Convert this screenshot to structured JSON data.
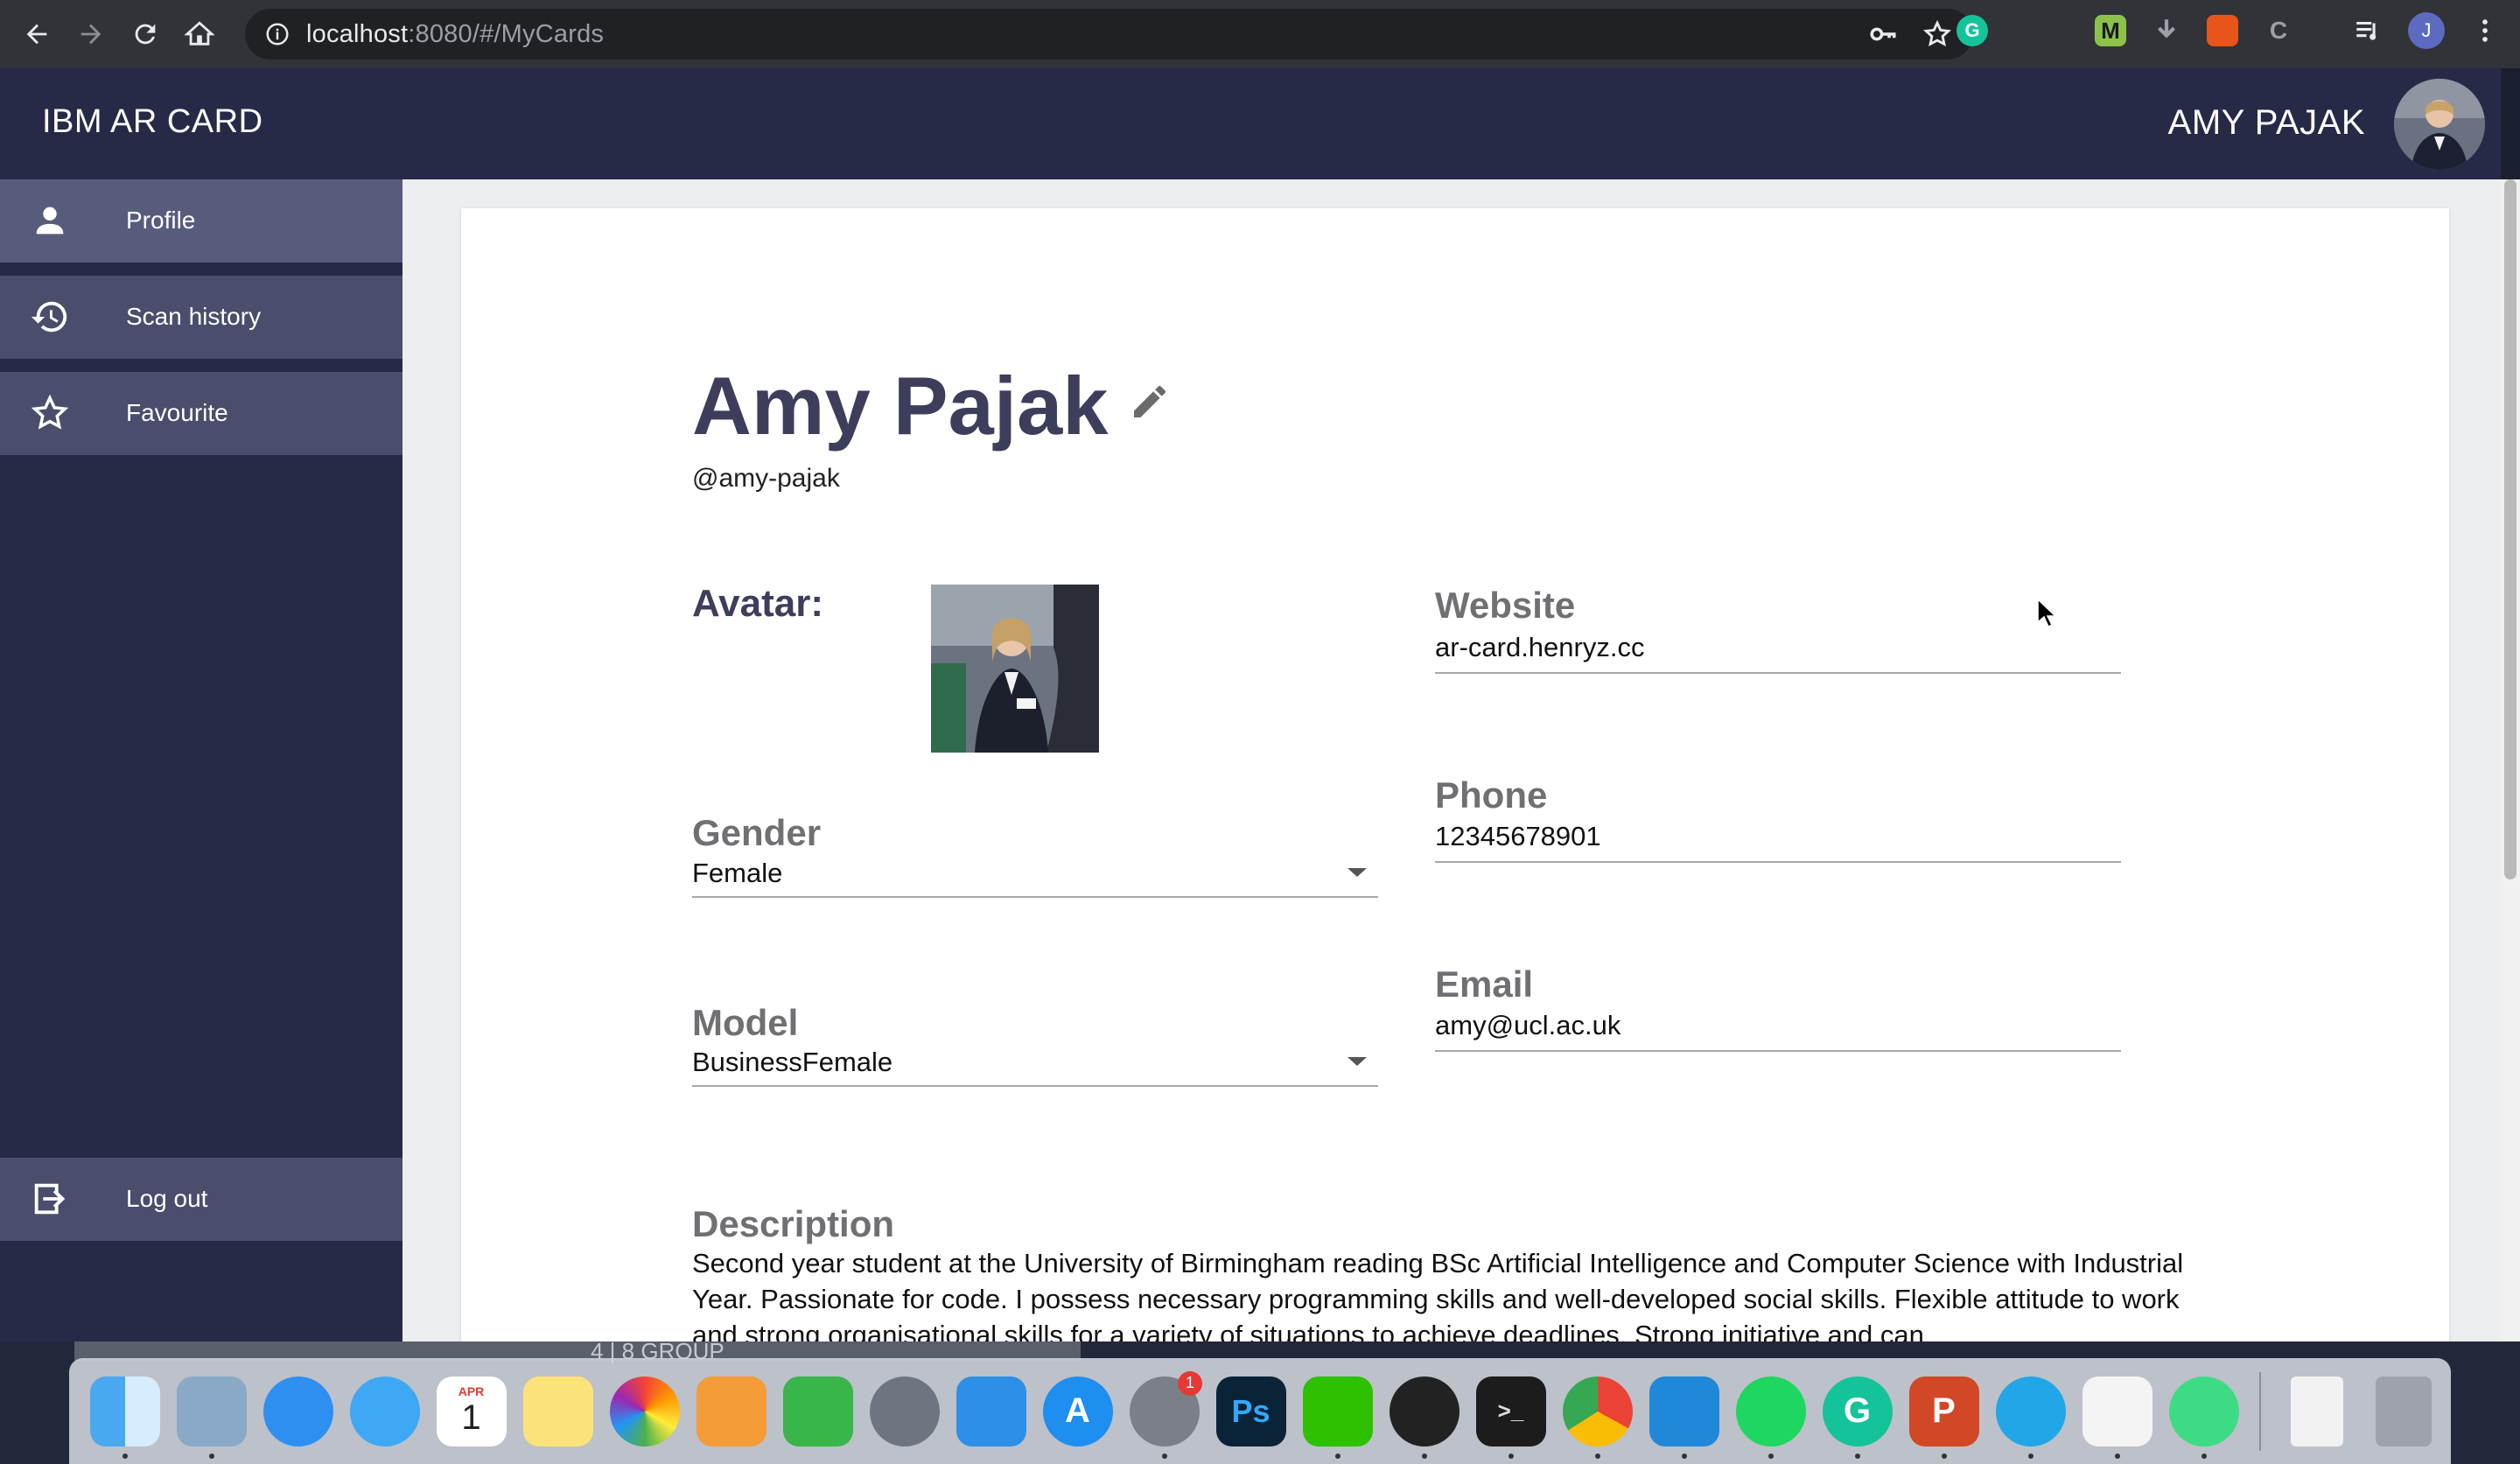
{
  "browser": {
    "url_host": "localhost",
    "url_rest": ":8080/#/MyCards",
    "profile_initial": "J",
    "ext_m": "M"
  },
  "app": {
    "title": "IBM AR CARD",
    "user_name": "AMY PAJAK"
  },
  "sidebar": {
    "items": [
      {
        "label": "Profile",
        "icon": "person-icon"
      },
      {
        "label": "Scan history",
        "icon": "history-icon"
      },
      {
        "label": "Favourite",
        "icon": "star-outline-icon"
      }
    ],
    "logout_label": "Log out"
  },
  "profile": {
    "name": "Amy Pajak",
    "handle": "@amy-pajak",
    "avatar_label": "Avatar:",
    "gender": {
      "label": "Gender",
      "value": "Female"
    },
    "model": {
      "label": "Model",
      "value": "BusinessFemale"
    },
    "website": {
      "label": "Website",
      "value": "ar-card.henryz.cc"
    },
    "phone": {
      "label": "Phone",
      "value": "12345678901"
    },
    "email": {
      "label": "Email",
      "value": "amy@ucl.ac.uk"
    },
    "description": {
      "label": "Description",
      "value": "Second year student at the University of Birmingham reading BSc Artificial Intelligence and Computer Science with Industrial Year. Passionate for code. I possess necessary programming skills and well-developed social skills. Flexible attitude to work and strong organisational skills for a variety of situations to achieve deadlines. Strong initiative and can"
    }
  },
  "dock": {
    "strip_text": "4 | 8 GROUP",
    "calendar_month": "APR",
    "calendar_day": "1",
    "sysprefs_badge": "1",
    "apps": [
      "finder",
      "preview",
      "safari",
      "messages",
      "calendar",
      "notes",
      "photos",
      "pages",
      "numbers",
      "launchpad",
      "keynote",
      "app-store",
      "system-preferences",
      "photoshop",
      "wechat",
      "qq",
      "terminal",
      "chrome",
      "vscode",
      "spotify",
      "grammarly",
      "powerpoint",
      "mindnode",
      "textedit",
      "android-studio",
      "html-file",
      "trash"
    ],
    "colors": {
      "accent": "#262a47",
      "sidebar_active": "#585c7c",
      "sidebar_item": "#4a4e6c"
    }
  }
}
